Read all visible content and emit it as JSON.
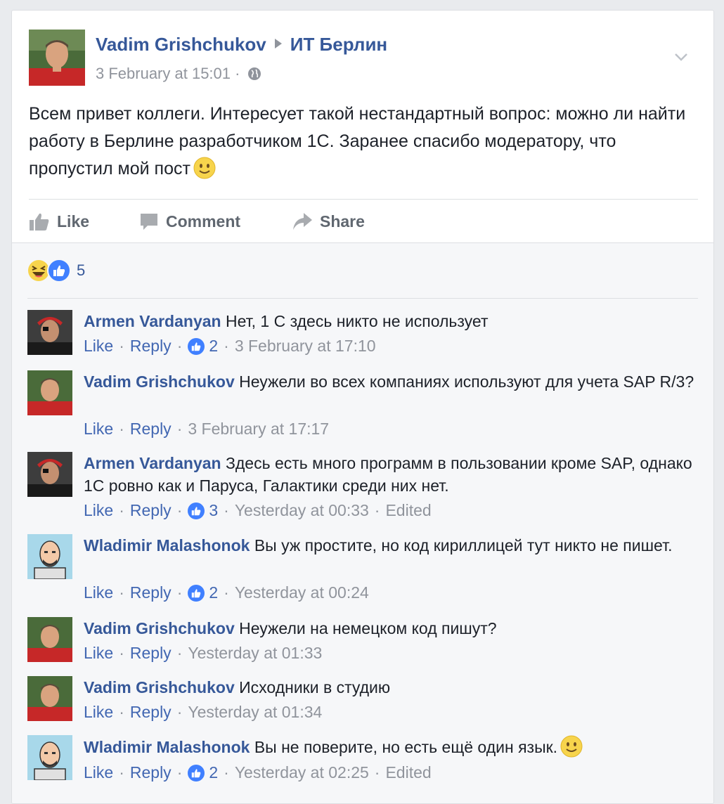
{
  "post": {
    "author": "Vadim Grishchukov",
    "group": "ИТ Берлин",
    "timestamp": "3 February at 15:01",
    "meta_sep": "·",
    "text": "Всем привет коллеги. Интересует такой нестандартный вопрос: можно ли найти работу в Берлине разработчиком 1С. Заранее спасибо модератору, что пропустил мой пост",
    "text_emoji": "smile-emoji",
    "icons": [
      "group-arrow-icon",
      "globe-icon",
      "chevron-down-icon"
    ]
  },
  "actions": {
    "like_label": "Like",
    "comment_label": "Comment",
    "share_label": "Share"
  },
  "reactions": {
    "icons": [
      "haha-reaction-icon",
      "like-reaction-icon"
    ],
    "count": "5"
  },
  "labels": {
    "like": "Like",
    "reply": "Reply",
    "dot": "·",
    "edited": "Edited"
  },
  "comments": [
    {
      "author": "Armen Vardanyan",
      "text": "Нет, 1 С здесь никто не использует",
      "likes": "2",
      "time": "3 February at 17:10",
      "edited": false
    },
    {
      "author": "Vadim Grishchukov",
      "text": "Неужели во всех компаниях используют для учета SAP R/3?",
      "likes": "",
      "time": "3 February at 17:17",
      "edited": false
    },
    {
      "author": "Armen Vardanyan",
      "text": "Здесь есть много программ в пользовании кроме SAP, однако 1С ровно как и Паруса, Галактики среди них нет.",
      "likes": "3",
      "time": "Yesterday at 00:33",
      "edited": true
    },
    {
      "author": "Wladimir Malashonok",
      "text": "Вы уж простите, но код кириллицей тут никто не пишет.",
      "likes": "2",
      "time": "Yesterday at 00:24",
      "edited": false
    },
    {
      "author": "Vadim Grishchukov",
      "text": "Неужели на немецком код пишут?",
      "likes": "",
      "time": "Yesterday at 01:33",
      "edited": false
    },
    {
      "author": "Vadim Grishchukov",
      "text": "Исходники в студию",
      "likes": "",
      "time": "Yesterday at 01:34",
      "edited": false
    },
    {
      "author": "Wladimir Malashonok",
      "text": "Вы не поверите, но есть ещё один язык.",
      "likes": "2",
      "time": "Yesterday at 02:25",
      "edited": true
    }
  ],
  "colors": {
    "link_blue": "#365899",
    "action_blue": "#4267b2",
    "like_blue": "#4080ff",
    "muted_gray": "#90949c",
    "background": "#e9ebee"
  }
}
